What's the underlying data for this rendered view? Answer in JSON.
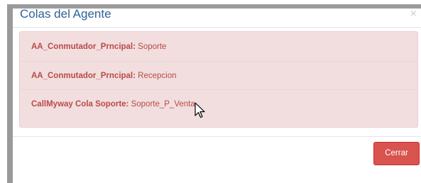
{
  "modal": {
    "title": "Colas del Agente",
    "close_symbol": "×",
    "queues": [
      {
        "name": "AA_Conmutador_Prncipal:",
        "value": " Soporte"
      },
      {
        "name": "AA_Conmutador_Prncipal:",
        "value": " Recepcion"
      },
      {
        "name": "CallMyway Cola Soporte:",
        "value": " Soporte_P_Venta"
      }
    ],
    "close_button_label": "Cerrar"
  },
  "colors": {
    "title": "#2e6199",
    "panel_background": "#f2dede",
    "panel_text": "#b94a48",
    "button_background": "#d9534f"
  },
  "icons": {
    "close": "close-icon",
    "cursor": "mouse-pointer-icon"
  }
}
